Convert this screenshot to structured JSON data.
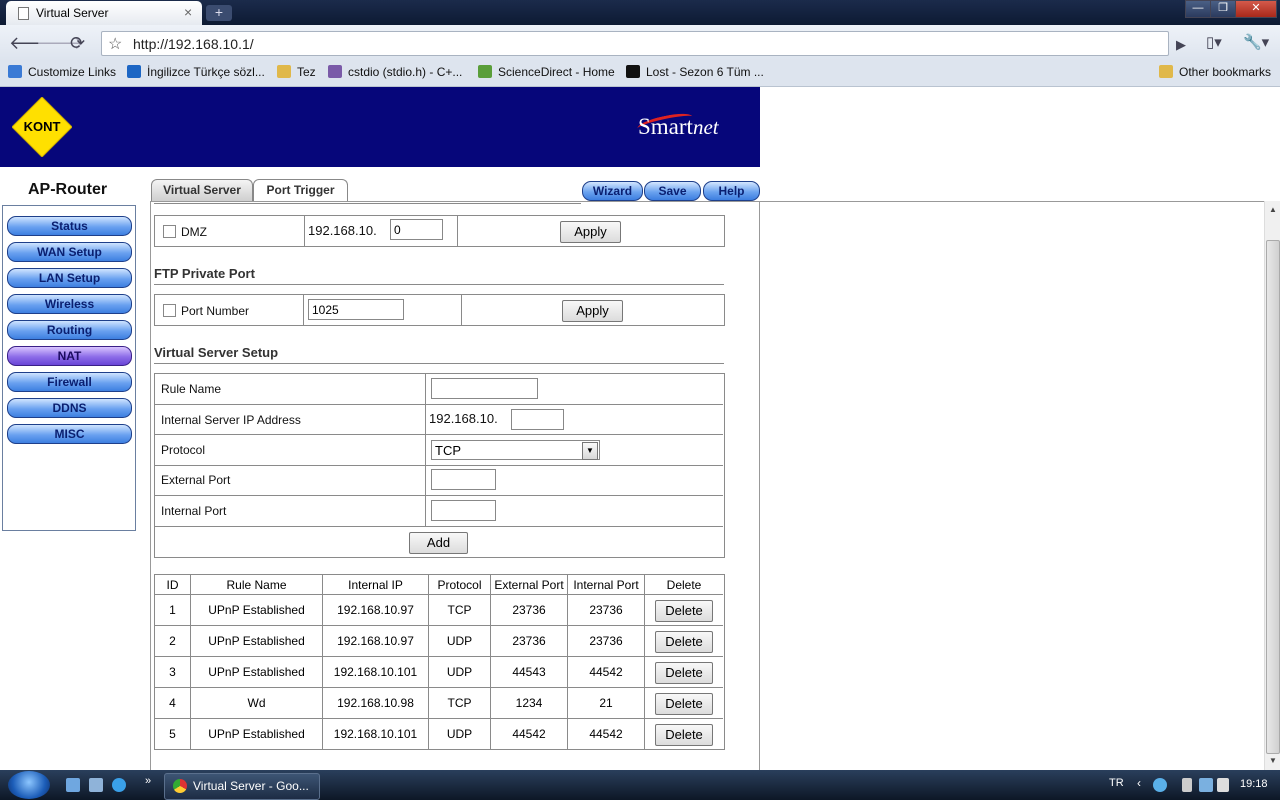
{
  "browser": {
    "tab_title": "Virtual Server",
    "tab_close": "×",
    "new_tab": "+",
    "url": "http://192.168.10.1/",
    "window_buttons": [
      "—",
      "❐",
      "✕"
    ]
  },
  "bookmarks": {
    "items": [
      {
        "label": "Customize Links",
        "icon": "page-icon",
        "color": "#3a7ad5"
      },
      {
        "label": "İngilizce Türkçe sözl...",
        "icon": "s-logo-icon",
        "color": "#1c66c4"
      },
      {
        "label": "Tez",
        "icon": "folder-icon",
        "color": "#e0b84a"
      },
      {
        "label": "cstdio (stdio.h) - C+...",
        "icon": "cplusplus-icon",
        "color": "#7a5aa8"
      },
      {
        "label": "ScienceDirect - Home",
        "icon": "sciencedirect-icon",
        "color": "#5a9e3a"
      },
      {
        "label": "Lost - Sezon 6 Tüm ...",
        "icon": "dm-icon",
        "color": "#111111"
      }
    ],
    "other": "Other bookmarks"
  },
  "router": {
    "brand": "KONT",
    "product": "Smart",
    "product_suffix": "net",
    "title": "AP-Router",
    "menu": [
      "Status",
      "WAN Setup",
      "LAN Setup",
      "Wireless",
      "Routing",
      "NAT",
      "Firewall",
      "DDNS",
      "MISC"
    ],
    "active_menu": "NAT",
    "tabs": [
      "Virtual Server",
      "Port Trigger"
    ],
    "top_buttons": [
      "Wizard",
      "Save",
      "Help"
    ]
  },
  "dmz": {
    "label": "DMZ",
    "ip_prefix": "192.168.10.",
    "ip_value": "0",
    "apply": "Apply"
  },
  "ftp": {
    "heading": "FTP Private Port",
    "label": "Port Number",
    "value": "1025",
    "apply": "Apply"
  },
  "vs_setup": {
    "heading": "Virtual Server Setup",
    "rule_name": "Rule Name",
    "internal_ip": "Internal Server IP Address",
    "ip_prefix": "192.168.10.",
    "protocol": "Protocol",
    "protocol_value": "TCP",
    "external_port": "External Port",
    "internal_port": "Internal Port",
    "add": "Add"
  },
  "table": {
    "headers": [
      "ID",
      "Rule Name",
      "Internal IP",
      "Protocol",
      "External Port",
      "Internal Port",
      "Delete"
    ],
    "rows": [
      [
        "1",
        "UPnP Established",
        "192.168.10.97",
        "TCP",
        "23736",
        "23736",
        "Delete"
      ],
      [
        "2",
        "UPnP Established",
        "192.168.10.97",
        "UDP",
        "23736",
        "23736",
        "Delete"
      ],
      [
        "3",
        "UPnP Established",
        "192.168.10.101",
        "UDP",
        "44543",
        "44542",
        "Delete"
      ],
      [
        "4",
        "Wd",
        "192.168.10.98",
        "TCP",
        "1234",
        "21",
        "Delete"
      ],
      [
        "5",
        "UPnP Established",
        "192.168.10.101",
        "UDP",
        "44542",
        "44542",
        "Delete"
      ]
    ]
  },
  "taskbar": {
    "task": "Virtual Server - Goo...",
    "lang": "TR",
    "time": "19:18"
  }
}
